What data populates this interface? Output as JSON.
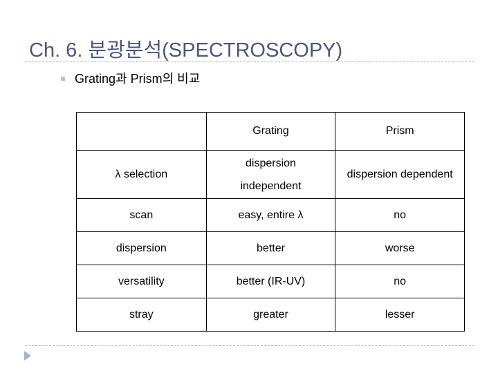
{
  "slide": {
    "title": "Ch. 6. 분광분석(SPECTROSCOPY)",
    "bullet": "Grating과 Prism의 비교",
    "colors": {
      "title": "#4a5682",
      "rule": "#b4b4b4",
      "nav_arrow": "#a3b4cc"
    }
  },
  "table": {
    "headers": [
      "",
      "Grating",
      "Prism"
    ],
    "lambda_row": {
      "label": "λ selection",
      "grating_line1": "dispersion",
      "grating_line2": "independent",
      "prism": "dispersion dependent"
    },
    "rows": [
      {
        "label": "scan",
        "grating": "easy, entire λ",
        "prism": "no"
      },
      {
        "label": "dispersion",
        "grating": "better",
        "prism": "worse"
      },
      {
        "label": "versatility",
        "grating": "better (IR-UV)",
        "prism": "no"
      },
      {
        "label": "stray",
        "grating": "greater",
        "prism": "lesser"
      }
    ]
  },
  "navigation": {
    "next_icon": "triangle-right-icon"
  }
}
